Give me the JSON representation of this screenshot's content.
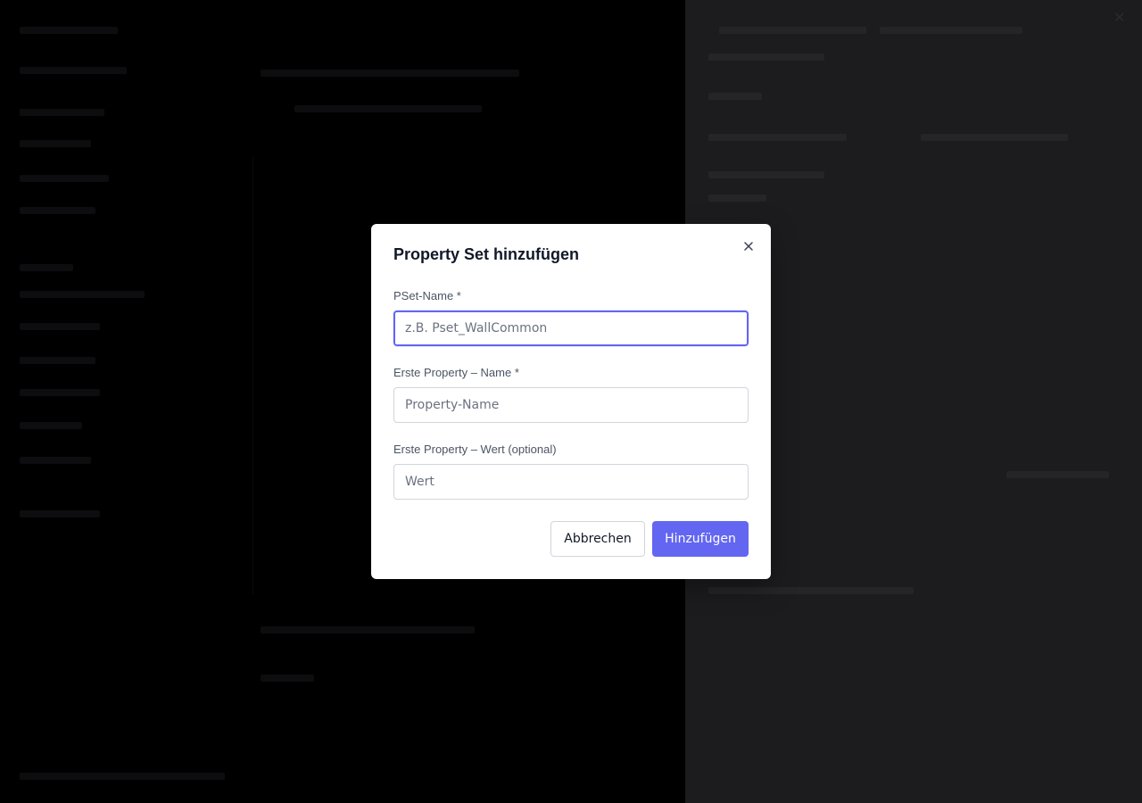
{
  "modal": {
    "title": "Property Set hinzufügen",
    "close_icon": "close-icon",
    "fields": [
      {
        "label": "PSet-Name *",
        "placeholder": "z.B. Pset_WallCommon",
        "value": ""
      },
      {
        "label": "Erste Property – Name *",
        "placeholder": "Property-Name",
        "value": ""
      },
      {
        "label": "Erste Property – Wert (optional)",
        "placeholder": "Wert",
        "value": ""
      }
    ],
    "cancel_label": "Abbrechen",
    "submit_label": "Hinzufügen"
  },
  "colors": {
    "accent": "#6366f1",
    "overlay": "#000000",
    "panel_dark": "#1c1c1e"
  }
}
